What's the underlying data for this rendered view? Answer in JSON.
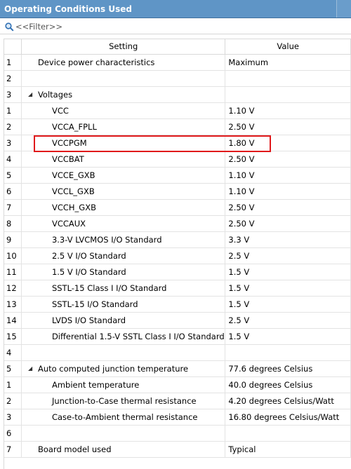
{
  "window": {
    "title": "Operating Conditions Used"
  },
  "filter": {
    "placeholder": "<<Filter>>"
  },
  "table": {
    "headers": {
      "setting": "Setting",
      "value": "Value"
    },
    "rows": [
      {
        "num": "1",
        "setting": "Device power characteristics",
        "value": "Maximum",
        "level": 1
      },
      {
        "num": "2",
        "setting": "",
        "value": "",
        "level": 1
      },
      {
        "num": "3",
        "setting": "Voltages",
        "value": "",
        "level": 1,
        "group": true
      },
      {
        "num": "1",
        "setting": "VCC",
        "value": "1.10 V",
        "level": 2
      },
      {
        "num": "2",
        "setting": "VCCA_FPLL",
        "value": "2.50 V",
        "level": 2
      },
      {
        "num": "3",
        "setting": "VCCPGM",
        "value": "1.80 V",
        "level": 2
      },
      {
        "num": "4",
        "setting": "VCCBAT",
        "value": "2.50 V",
        "level": 2
      },
      {
        "num": "5",
        "setting": "VCCE_GXB",
        "value": "1.10 V",
        "level": 2
      },
      {
        "num": "6",
        "setting": "VCCL_GXB",
        "value": "1.10 V",
        "level": 2
      },
      {
        "num": "7",
        "setting": "VCCH_GXB",
        "value": "2.50 V",
        "level": 2
      },
      {
        "num": "8",
        "setting": "VCCAUX",
        "value": "2.50 V",
        "level": 2
      },
      {
        "num": "9",
        "setting": "3.3-V LVCMOS I/O Standard",
        "value": "3.3 V",
        "level": 2
      },
      {
        "num": "10",
        "setting": "2.5 V I/O Standard",
        "value": "2.5 V",
        "level": 2
      },
      {
        "num": "11",
        "setting": "1.5 V I/O Standard",
        "value": "1.5 V",
        "level": 2
      },
      {
        "num": "12",
        "setting": "SSTL-15 Class I I/O Standard",
        "value": "1.5 V",
        "level": 2
      },
      {
        "num": "13",
        "setting": "SSTL-15 I/O Standard",
        "value": "1.5 V",
        "level": 2
      },
      {
        "num": "14",
        "setting": "LVDS I/O Standard",
        "value": "2.5 V",
        "level": 2
      },
      {
        "num": "15",
        "setting": "Differential 1.5-V SSTL Class I I/O Standard",
        "value": "1.5 V",
        "level": 2
      },
      {
        "num": "4",
        "setting": "",
        "value": "",
        "level": 1
      },
      {
        "num": "5",
        "setting": "Auto computed junction temperature",
        "value": "77.6 degrees Celsius",
        "level": 1,
        "group": true
      },
      {
        "num": "1",
        "setting": "Ambient temperature",
        "value": "40.0 degrees Celsius",
        "level": 2
      },
      {
        "num": "2",
        "setting": "Junction-to-Case thermal resistance",
        "value": "4.20 degrees Celsius/Watt",
        "level": 2
      },
      {
        "num": "3",
        "setting": "Case-to-Ambient thermal resistance",
        "value": "16.80 degrees Celsius/Watt",
        "level": 2
      },
      {
        "num": "6",
        "setting": "",
        "value": "",
        "level": 1
      },
      {
        "num": "7",
        "setting": "Board model used",
        "value": "Typical",
        "level": 1
      }
    ]
  },
  "colors": {
    "titlebar": "#5f95c6",
    "highlight": "#e0191b"
  },
  "icons": {
    "filter": "search-icon",
    "expand": "expanded-triangle-icon"
  }
}
